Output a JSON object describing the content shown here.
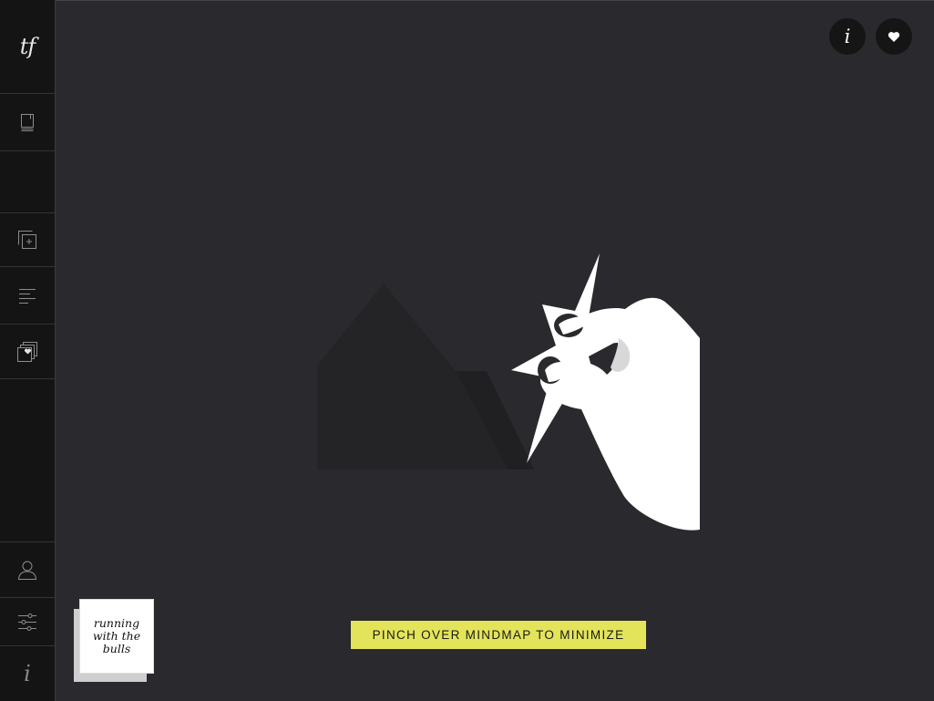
{
  "sidebar": {
    "logo_text": "tf",
    "items": [
      {
        "icon": "notebook-icon"
      },
      {
        "icon": "blank"
      },
      {
        "icon": "add-page-icon"
      },
      {
        "icon": "text-lines-icon"
      },
      {
        "icon": "favorites-stack-icon"
      },
      {
        "icon": "user-icon"
      },
      {
        "icon": "sliders-icon"
      }
    ],
    "info_text": "i"
  },
  "topbar": {
    "info_label": "i",
    "favorite_icon": "heart-icon"
  },
  "hint": {
    "text": "PINCH OVER MINDMAP TO MINIMIZE",
    "background": "#e3e45a"
  },
  "card": {
    "lines": [
      "running",
      "with the",
      "bulls"
    ]
  },
  "colors": {
    "background": "#2a292d",
    "sidebar": "#141414",
    "accent": "#e3e45a"
  }
}
